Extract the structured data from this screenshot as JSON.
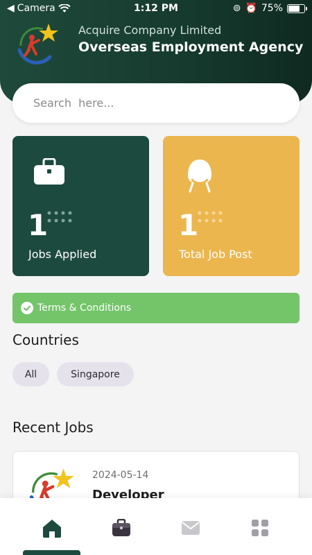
{
  "status_bar": {
    "back_app": "Camera",
    "time": "1:12 PM",
    "battery_text": "75%",
    "battery_level": 0.75
  },
  "header": {
    "company": "Acquire Company Limited",
    "agency": "Overseas Employment Agency"
  },
  "search": {
    "placeholder": "Search  here..."
  },
  "cards": [
    {
      "value": "1",
      "label": "Jobs Applied",
      "icon": "briefcase-icon",
      "color": "#1d4a3e"
    },
    {
      "value": "1",
      "label": "Total Job Post",
      "icon": "chair-icon",
      "color": "#ecb64e"
    }
  ],
  "terms": {
    "label": "Terms & Conditions",
    "color": "#74c46a"
  },
  "countries": {
    "title": "Countries",
    "chips": [
      "All",
      "Singapore"
    ]
  },
  "recent_jobs": {
    "title": "Recent Jobs",
    "items": [
      {
        "date": "2024-05-14",
        "title": "Developer"
      }
    ]
  },
  "bottom_nav": {
    "items": [
      "home-icon",
      "briefcase-icon",
      "mail-icon",
      "grid-icon"
    ],
    "active": "home-icon"
  }
}
